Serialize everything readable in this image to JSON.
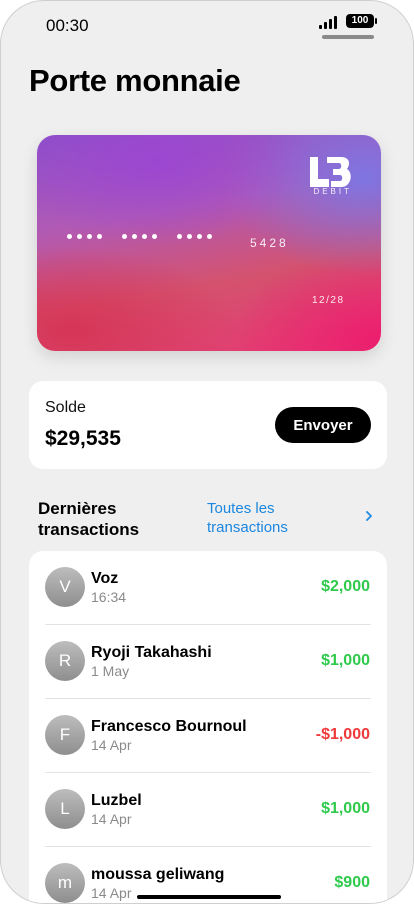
{
  "status_bar": {
    "time": "00:30",
    "battery": "100"
  },
  "page_title": "Porte monnaie",
  "card": {
    "brand_sub": "DEBIT",
    "last4": "5428",
    "expiry": "12/28"
  },
  "balance": {
    "label": "Solde",
    "value": "$29,535",
    "send_label": "Envoyer"
  },
  "transactions_header": {
    "title": "Dernières transactions",
    "all_link": "Toutes les transactions"
  },
  "transactions": [
    {
      "initial": "V",
      "name": "Voz",
      "date": "16:34",
      "amount": "$2,000",
      "type": "positive"
    },
    {
      "initial": "R",
      "name": "Ryoji Takahashi",
      "date": "1 May",
      "amount": "$1,000",
      "type": "positive"
    },
    {
      "initial": "F",
      "name": "Francesco Bournoul",
      "date": "14 Apr",
      "amount": "-$1,000",
      "type": "negative"
    },
    {
      "initial": "L",
      "name": "Luzbel",
      "date": "14 Apr",
      "amount": "$1,000",
      "type": "positive"
    },
    {
      "initial": "m",
      "name": "moussa geliwang",
      "date": "14 Apr",
      "amount": "$900",
      "type": "positive"
    }
  ],
  "colors": {
    "positive": "#2fca4c",
    "negative": "#f03a3a",
    "link": "#1b87e0"
  }
}
